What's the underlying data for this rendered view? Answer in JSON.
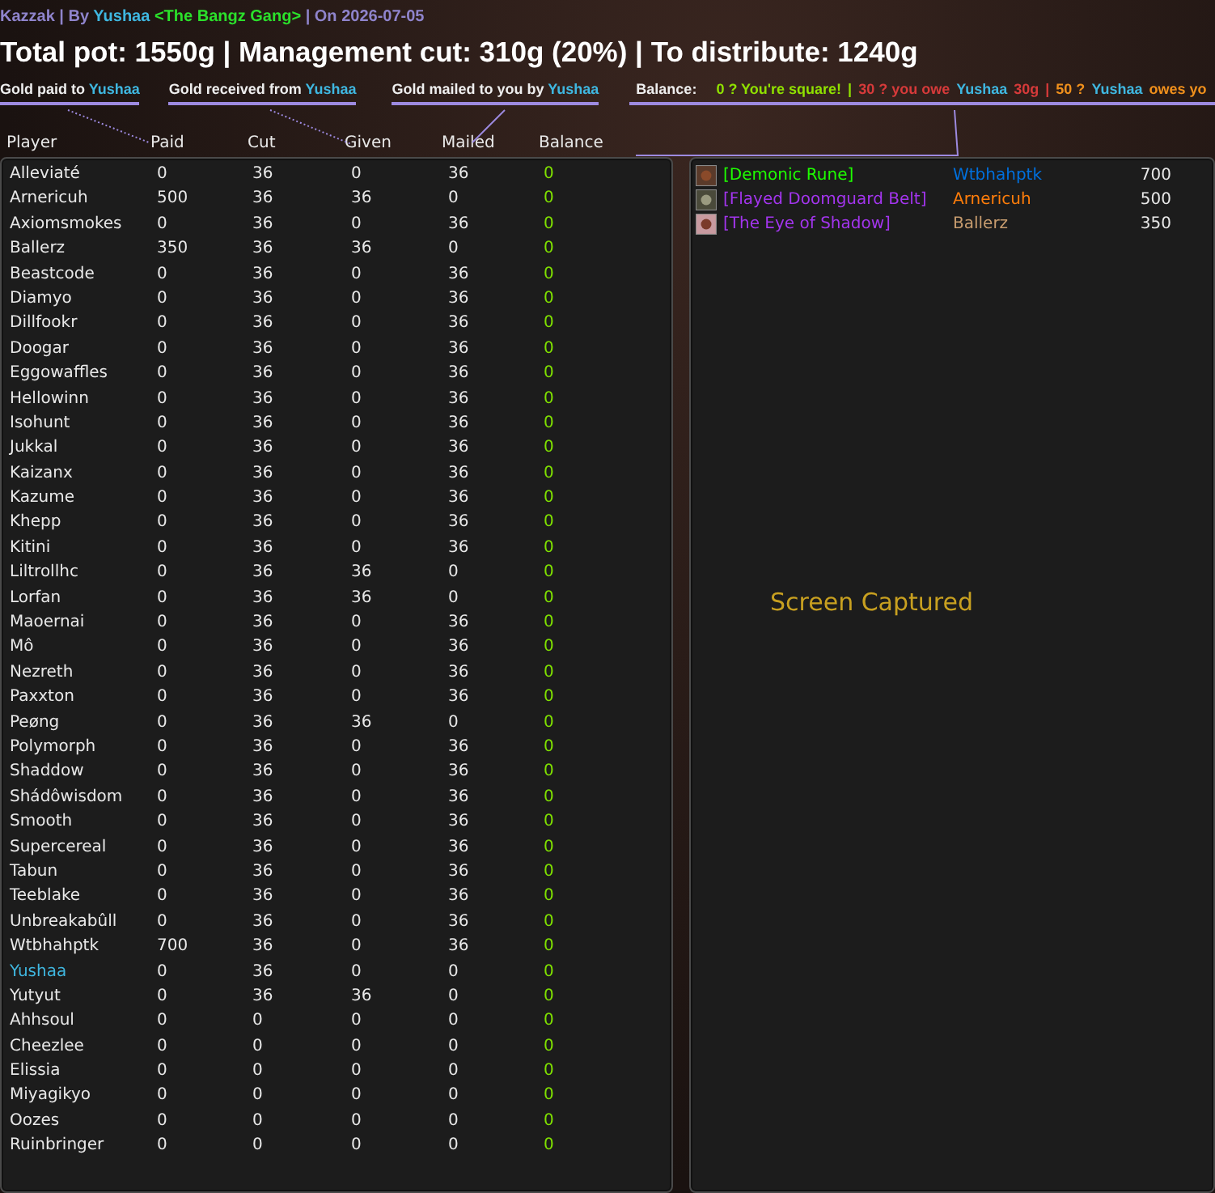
{
  "header": {
    "segments": [
      {
        "text": "Kazzak | By ",
        "kind": "plain"
      },
      {
        "text": "Yushaa",
        "kind": "player"
      },
      {
        "text": " <The Bangz Gang>",
        "kind": "guild"
      },
      {
        "text": " | On 2026-07-05",
        "kind": "plain"
      }
    ]
  },
  "title": "Total pot: 1550g | Management cut: 310g (20%) | To distribute: 1240g",
  "legend": [
    {
      "label": "Gold paid to",
      "name": "Yushaa"
    },
    {
      "label": "Gold received from",
      "name": "Yushaa"
    },
    {
      "label": "Gold mailed to you by",
      "name": "Yushaa"
    }
  ],
  "balance_legend": {
    "label": "Balance:",
    "segments": [
      {
        "text": "0 ? You're square!",
        "kind": "even"
      },
      {
        "text": "|",
        "kind": "sep_even"
      },
      {
        "text": "30 ? you owe",
        "kind": "owe"
      },
      {
        "text": "Yushaa",
        "kind": "player"
      },
      {
        "text": "30g",
        "kind": "owe"
      },
      {
        "text": "|",
        "kind": "sep_owe"
      },
      {
        "text": "50 ?",
        "kind": "owed"
      },
      {
        "text": "Yushaa",
        "kind": "player"
      },
      {
        "text": "owes yo",
        "kind": "owed"
      }
    ]
  },
  "table": {
    "columns": [
      "Player",
      "Paid",
      "Cut",
      "Given",
      "Mailed",
      "Balance"
    ],
    "rows": [
      {
        "player": "Alleviaté",
        "paid": "0",
        "cut": "36",
        "given": "0",
        "mailed": "36",
        "balance": "0",
        "self": false
      },
      {
        "player": "Arnericuh",
        "paid": "500",
        "cut": "36",
        "given": "36",
        "mailed": "0",
        "balance": "0",
        "self": false
      },
      {
        "player": "Axiomsmokes",
        "paid": "0",
        "cut": "36",
        "given": "0",
        "mailed": "36",
        "balance": "0",
        "self": false
      },
      {
        "player": "Ballerz",
        "paid": "350",
        "cut": "36",
        "given": "36",
        "mailed": "0",
        "balance": "0",
        "self": false
      },
      {
        "player": "Beastcode",
        "paid": "0",
        "cut": "36",
        "given": "0",
        "mailed": "36",
        "balance": "0",
        "self": false
      },
      {
        "player": "Diamyo",
        "paid": "0",
        "cut": "36",
        "given": "0",
        "mailed": "36",
        "balance": "0",
        "self": false
      },
      {
        "player": "Dillfookr",
        "paid": "0",
        "cut": "36",
        "given": "0",
        "mailed": "36",
        "balance": "0",
        "self": false
      },
      {
        "player": "Doogar",
        "paid": "0",
        "cut": "36",
        "given": "0",
        "mailed": "36",
        "balance": "0",
        "self": false
      },
      {
        "player": "Eggowaffles",
        "paid": "0",
        "cut": "36",
        "given": "0",
        "mailed": "36",
        "balance": "0",
        "self": false
      },
      {
        "player": "Hellowinn",
        "paid": "0",
        "cut": "36",
        "given": "0",
        "mailed": "36",
        "balance": "0",
        "self": false
      },
      {
        "player": "Isohunt",
        "paid": "0",
        "cut": "36",
        "given": "0",
        "mailed": "36",
        "balance": "0",
        "self": false
      },
      {
        "player": "Jukkal",
        "paid": "0",
        "cut": "36",
        "given": "0",
        "mailed": "36",
        "balance": "0",
        "self": false
      },
      {
        "player": "Kaizanx",
        "paid": "0",
        "cut": "36",
        "given": "0",
        "mailed": "36",
        "balance": "0",
        "self": false
      },
      {
        "player": "Kazume",
        "paid": "0",
        "cut": "36",
        "given": "0",
        "mailed": "36",
        "balance": "0",
        "self": false
      },
      {
        "player": "Khepp",
        "paid": "0",
        "cut": "36",
        "given": "0",
        "mailed": "36",
        "balance": "0",
        "self": false
      },
      {
        "player": "Kitini",
        "paid": "0",
        "cut": "36",
        "given": "0",
        "mailed": "36",
        "balance": "0",
        "self": false
      },
      {
        "player": "Liltrollhc",
        "paid": "0",
        "cut": "36",
        "given": "36",
        "mailed": "0",
        "balance": "0",
        "self": false
      },
      {
        "player": "Lorfan",
        "paid": "0",
        "cut": "36",
        "given": "36",
        "mailed": "0",
        "balance": "0",
        "self": false
      },
      {
        "player": "Maoernai",
        "paid": "0",
        "cut": "36",
        "given": "0",
        "mailed": "36",
        "balance": "0",
        "self": false
      },
      {
        "player": "Mô",
        "paid": "0",
        "cut": "36",
        "given": "0",
        "mailed": "36",
        "balance": "0",
        "self": false
      },
      {
        "player": "Nezreth",
        "paid": "0",
        "cut": "36",
        "given": "0",
        "mailed": "36",
        "balance": "0",
        "self": false
      },
      {
        "player": "Paxxton",
        "paid": "0",
        "cut": "36",
        "given": "0",
        "mailed": "36",
        "balance": "0",
        "self": false
      },
      {
        "player": "Peøng",
        "paid": "0",
        "cut": "36",
        "given": "36",
        "mailed": "0",
        "balance": "0",
        "self": false
      },
      {
        "player": "Polymorph",
        "paid": "0",
        "cut": "36",
        "given": "0",
        "mailed": "36",
        "balance": "0",
        "self": false
      },
      {
        "player": "Shaddow",
        "paid": "0",
        "cut": "36",
        "given": "0",
        "mailed": "36",
        "balance": "0",
        "self": false
      },
      {
        "player": "Shádôwisdom",
        "paid": "0",
        "cut": "36",
        "given": "0",
        "mailed": "36",
        "balance": "0",
        "self": false
      },
      {
        "player": "Smooth",
        "paid": "0",
        "cut": "36",
        "given": "0",
        "mailed": "36",
        "balance": "0",
        "self": false
      },
      {
        "player": "Supercereal",
        "paid": "0",
        "cut": "36",
        "given": "0",
        "mailed": "36",
        "balance": "0",
        "self": false
      },
      {
        "player": "Tabun",
        "paid": "0",
        "cut": "36",
        "given": "0",
        "mailed": "36",
        "balance": "0",
        "self": false
      },
      {
        "player": "Teeblake",
        "paid": "0",
        "cut": "36",
        "given": "0",
        "mailed": "36",
        "balance": "0",
        "self": false
      },
      {
        "player": "Unbreakabûll",
        "paid": "0",
        "cut": "36",
        "given": "0",
        "mailed": "36",
        "balance": "0",
        "self": false
      },
      {
        "player": "Wtbhahptk",
        "paid": "700",
        "cut": "36",
        "given": "0",
        "mailed": "36",
        "balance": "0",
        "self": false
      },
      {
        "player": "Yushaa",
        "paid": "0",
        "cut": "36",
        "given": "0",
        "mailed": "0",
        "balance": "0",
        "self": true
      },
      {
        "player": "Yutyut",
        "paid": "0",
        "cut": "36",
        "given": "36",
        "mailed": "0",
        "balance": "0",
        "self": false
      },
      {
        "player": "Ahhsoul",
        "paid": "0",
        "cut": "0",
        "given": "0",
        "mailed": "0",
        "balance": "0",
        "self": false
      },
      {
        "player": "Cheezlee",
        "paid": "0",
        "cut": "0",
        "given": "0",
        "mailed": "0",
        "balance": "0",
        "self": false
      },
      {
        "player": "Elissia",
        "paid": "0",
        "cut": "0",
        "given": "0",
        "mailed": "0",
        "balance": "0",
        "self": false
      },
      {
        "player": "Miyagikyo",
        "paid": "0",
        "cut": "0",
        "given": "0",
        "mailed": "0",
        "balance": "0",
        "self": false
      },
      {
        "player": "Oozes",
        "paid": "0",
        "cut": "0",
        "given": "0",
        "mailed": "0",
        "balance": "0",
        "self": false
      },
      {
        "player": "Ruinbringer",
        "paid": "0",
        "cut": "0",
        "given": "0",
        "mailed": "0",
        "balance": "0",
        "self": false
      }
    ]
  },
  "loot": [
    {
      "item": "[Demonic Rune]",
      "color": "#1eff00",
      "winner": {
        "name": "Wtbhahptk",
        "color": "#0070dd"
      },
      "amount": "700"
    },
    {
      "item": "[Flayed Doomguard Belt]",
      "color": "#a335ee",
      "winner": {
        "name": "Arnericuh",
        "color": "#ff7d0a"
      },
      "amount": "500"
    },
    {
      "item": "[The Eye of Shadow]",
      "color": "#a335ee",
      "winner": {
        "name": "Ballerz",
        "color": "#c79c6e"
      },
      "amount": "350"
    }
  ],
  "overlay_text": "Screen Captured"
}
